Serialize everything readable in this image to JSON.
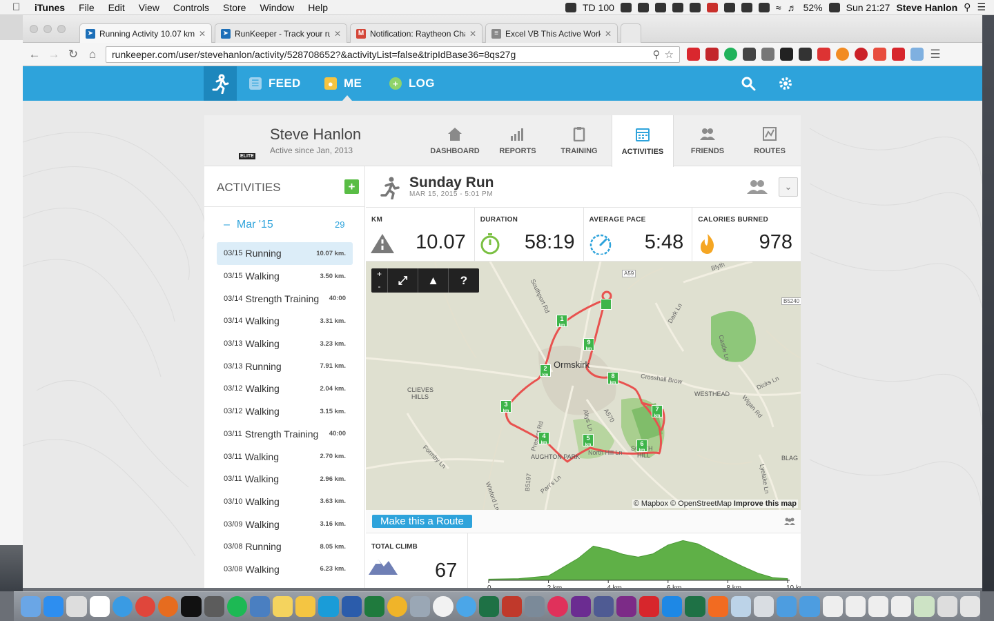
{
  "menubar": {
    "app_name": "iTunes",
    "menus": [
      "File",
      "Edit",
      "View",
      "Controls",
      "Store",
      "Window",
      "Help"
    ],
    "td_count": "100",
    "battery": "52%",
    "clock": "Sun 21:27",
    "user": "Steve Hanlon"
  },
  "browser": {
    "tabs": [
      {
        "title": "Running Activity 10.07 km",
        "favicon_color": "#1d6fb8"
      },
      {
        "title": "RunKeeper - Track your ru",
        "favicon_color": "#1d6fb8"
      },
      {
        "title": "Notification: Raytheon Cha",
        "favicon_color": "#d44638"
      },
      {
        "title": "Excel VB This Active Work",
        "favicon_color": "#888888"
      }
    ],
    "url": "runkeeper.com/user/stevehanlon/activity/528708652?&activityList=false&tripIdBase36=8qs27g"
  },
  "topnav": {
    "feed": "FEED",
    "me": "ME",
    "log": "LOG"
  },
  "profile": {
    "name": "Steve Hanlon",
    "since": "Active since Jan, 2013",
    "badge": "ELITE",
    "tabs": [
      "DASHBOARD",
      "REPORTS",
      "TRAINING",
      "ACTIVITIES",
      "FRIENDS",
      "ROUTES"
    ]
  },
  "sidebar": {
    "title": "ACTIVITIES",
    "add": "+",
    "month": "Mar '15",
    "month_count": "29",
    "activities": [
      {
        "date": "03/15",
        "type": "Running",
        "value": "10.07 km."
      },
      {
        "date": "03/15",
        "type": "Walking",
        "value": "3.50 km."
      },
      {
        "date": "03/14",
        "type": "Strength Training",
        "value": "40:00"
      },
      {
        "date": "03/14",
        "type": "Walking",
        "value": "3.31 km."
      },
      {
        "date": "03/13",
        "type": "Walking",
        "value": "3.23 km."
      },
      {
        "date": "03/13",
        "type": "Running",
        "value": "7.91 km."
      },
      {
        "date": "03/12",
        "type": "Walking",
        "value": "2.04 km."
      },
      {
        "date": "03/12",
        "type": "Walking",
        "value": "3.15 km."
      },
      {
        "date": "03/11",
        "type": "Strength Training",
        "value": "40:00"
      },
      {
        "date": "03/11",
        "type": "Walking",
        "value": "2.70 km."
      },
      {
        "date": "03/11",
        "type": "Walking",
        "value": "2.96 km."
      },
      {
        "date": "03/10",
        "type": "Walking",
        "value": "3.63 km."
      },
      {
        "date": "03/09",
        "type": "Walking",
        "value": "3.16 km."
      },
      {
        "date": "03/08",
        "type": "Running",
        "value": "8.05 km."
      },
      {
        "date": "03/08",
        "type": "Walking",
        "value": "6.23 km."
      }
    ]
  },
  "activity": {
    "title": "Sunday Run",
    "date": "MAR 15, 2015  -  5:01 PM",
    "stats": [
      {
        "label": "KM",
        "value": "10.07"
      },
      {
        "label": "DURATION",
        "value": "58:19"
      },
      {
        "label": "AVERAGE PACE",
        "value": "5:48"
      },
      {
        "label": "CALORIES BURNED",
        "value": "978"
      }
    ]
  },
  "map": {
    "zoom_in": "+",
    "zoom_out": "-",
    "help": "?",
    "credit_text": "© Mapbox © OpenStreetMap ",
    "credit_link": "Improve this map",
    "places": {
      "town": "Ormskirk",
      "cleives": "CLIEVES",
      "hills": "HILLS",
      "westhead": "WESTHEAD",
      "aughton": "AUGHTON PARK",
      "blag": "BLAG",
      "south": "SOUTH",
      "hill": "HILL",
      "crosshall": "Crosshall Brow",
      "a59": "A59",
      "b5240": "B5240",
      "a570": "A570",
      "b5197": "B5197",
      "southport": "Southport Rd",
      "prescot": "Prescot Rd",
      "formby": "Formby Ln",
      "winford": "Winford Ln",
      "parrs": "Parr's Ln",
      "dark": "Dark Ln",
      "castle": "Castle Ln",
      "dicks": "Dicks Ln",
      "wigan": "Wigan Rd",
      "lyelake": "Lyelake Ln",
      "blyth": "Blyth",
      "altys": "Altys Ln",
      "north_hill": "North Hill Ln"
    },
    "km_markers": [
      "1",
      "2",
      "3",
      "4",
      "5",
      "6",
      "7",
      "8",
      "9"
    ],
    "km_unit": "km"
  },
  "route": {
    "button": "Make this a Route"
  },
  "elevation": {
    "label": "TOTAL CLIMB",
    "value": "67",
    "chart_data": {
      "type": "area",
      "x": [
        0,
        1,
        2,
        3,
        3.5,
        4,
        4.5,
        5,
        5.5,
        6,
        6.5,
        7,
        7.5,
        8,
        8.5,
        9,
        9.5,
        10
      ],
      "y": [
        2,
        3,
        8,
        40,
        62,
        56,
        47,
        42,
        48,
        64,
        72,
        66,
        52,
        38,
        25,
        13,
        5,
        3
      ],
      "x_tick_labels": [
        "0",
        "2 km",
        "4 km",
        "6 km",
        "8 km",
        "10 km"
      ],
      "x_ticks": [
        0,
        2,
        4,
        6,
        8,
        10
      ],
      "xlim": [
        0,
        10.07
      ],
      "ylim": [
        0,
        80
      ],
      "color": "#5fb047"
    }
  },
  "colors": {
    "brand_blue": "#2ea3db",
    "brand_dark": "#1d87bd",
    "green": "#59bd45",
    "route_red": "#e8524f"
  }
}
